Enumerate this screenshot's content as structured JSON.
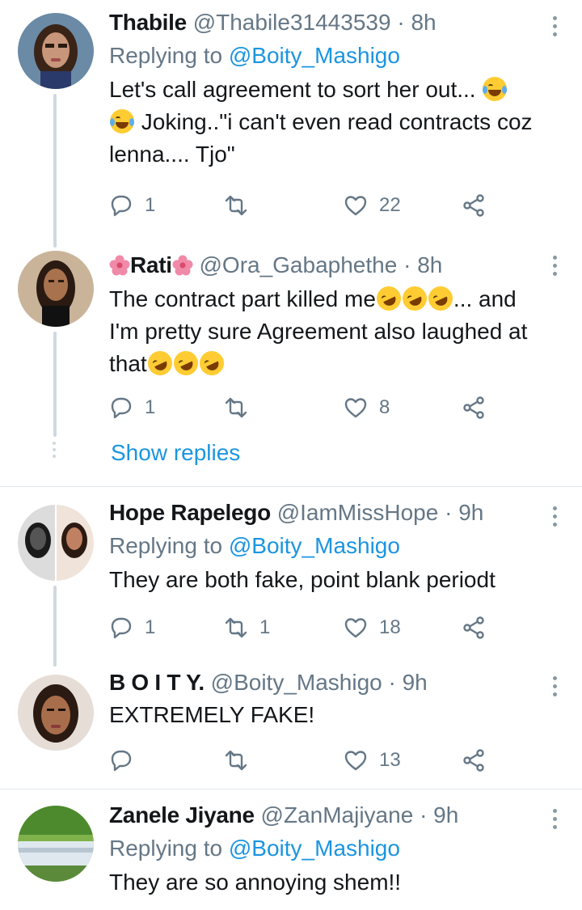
{
  "tweets": [
    {
      "name": "Thabile",
      "handle": "@Thabile31443539",
      "time": "8h",
      "reply_label": "Replying to",
      "reply_mention": "@Boity_Mashigo",
      "text_parts": [
        "Let's call agreement to sort her out... ",
        " Joking..\"i can't even read contracts coz lenna.... Tjo\""
      ],
      "replies": "1",
      "retweets": "",
      "likes": "22",
      "avatar_colors": [
        "#3a2a24",
        "#c8a088"
      ]
    },
    {
      "name": "Rati",
      "handle": "@Ora_Gabaphethe",
      "time": "8h",
      "text_parts": [
        "The contract part killed me",
        "... and I'm pretty sure Agreement also laughed at that"
      ],
      "replies": "1",
      "retweets": "",
      "likes": "8",
      "show_replies": "Show replies",
      "avatar_colors": [
        "#2b1a12",
        "#b58060"
      ]
    },
    {
      "name": "Hope Rapelego",
      "handle": "@IamMissHope",
      "time": "9h",
      "reply_label": "Replying to",
      "reply_mention": "@Boity_Mashigo",
      "text": "They are both fake, point blank periodt",
      "replies": "1",
      "retweets": "1",
      "likes": "18",
      "avatar_colors": [
        "#1a1a1a",
        "#c87a5a"
      ]
    },
    {
      "name": "B O I T Y.",
      "handle": "@Boity_Mashigo",
      "time": "9h",
      "text": "EXTREMELY FAKE!",
      "replies": "",
      "retweets": "",
      "likes": "13",
      "avatar_colors": [
        "#2a1a12",
        "#b07a5a"
      ]
    },
    {
      "name": "Zanele Jiyane",
      "handle": "@ZanMajiyane",
      "time": "9h",
      "reply_label": "Replying to",
      "reply_mention": "@Boity_Mashigo",
      "text": "They are so annoying shem!!",
      "avatar_colors": [
        "#5a9a3a",
        "#dfe8ef"
      ]
    }
  ],
  "icons": {
    "reply": "reply-icon",
    "retweet": "retweet-icon",
    "like": "heart-icon",
    "share": "share-icon",
    "more": "more-options-icon"
  },
  "colors": {
    "link": "#1b95e0",
    "muted": "#657786"
  }
}
